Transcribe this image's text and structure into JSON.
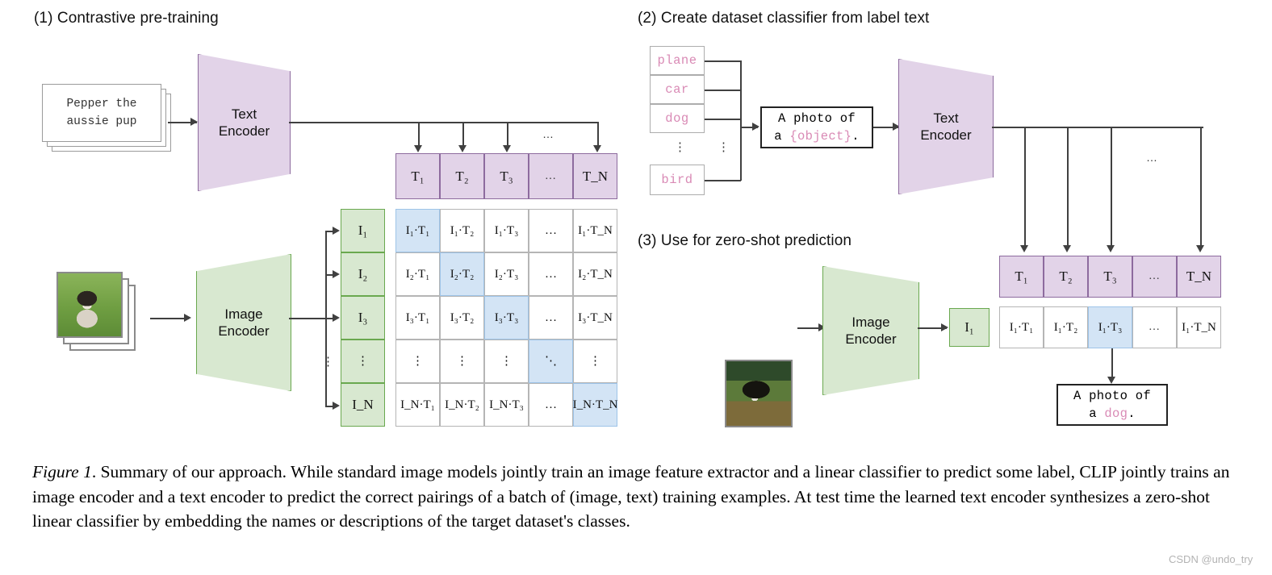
{
  "figure": {
    "watermark": "CSDN @undo_try",
    "caption_lead": "Figure 1",
    "caption_rest": ". Summary of our approach. While standard image models jointly train an image feature extractor and a linear classifier to predict some label, CLIP jointly trains an image encoder and a text encoder to predict the correct pairings of a batch of (image, text) training examples. At test time the learned text encoder synthesizes a zero-shot linear classifier by embedding the names or descriptions of the target dataset's classes."
  },
  "panel1": {
    "title": "(1) Contrastive pre-training",
    "text_sample_line1": "Pepper the",
    "text_sample_line2": "aussie pup",
    "text_encoder": {
      "line1": "Text",
      "line2": "Encoder"
    },
    "image_encoder": {
      "line1": "Image",
      "line2": "Encoder"
    },
    "text_vector": [
      "T₁",
      "T₂",
      "T₃",
      "…",
      "T_N"
    ],
    "image_vector": [
      "I₁",
      "I₂",
      "I₃",
      "⋮",
      "I_N"
    ],
    "matrix_rows": [
      [
        "I₁·T₁",
        "I₁·T₂",
        "I₁·T₃",
        "…",
        "I₁·T_N"
      ],
      [
        "I₂·T₁",
        "I₂·T₂",
        "I₂·T₃",
        "…",
        "I₂·T_N"
      ],
      [
        "I₃·T₁",
        "I₃·T₂",
        "I₃·T₃",
        "…",
        "I₃·T_N"
      ],
      [
        "⋮",
        "⋮",
        "⋮",
        "⋱",
        "⋮"
      ],
      [
        "I_N·T₁",
        "I_N·T₂",
        "I_N·T₃",
        "…",
        "I_N·T_N"
      ]
    ],
    "diagonal_highlight": [
      0,
      1,
      2,
      3,
      4
    ]
  },
  "panel2": {
    "title": "(2) Create dataset classifier from label text",
    "class_labels": [
      "plane",
      "car",
      "dog",
      "bird"
    ],
    "ellipsis": "⋮",
    "prompt_prefix": "A photo of",
    "prompt_article": "a ",
    "prompt_slot": "{object}",
    "prompt_suffix": ".",
    "text_encoder": {
      "line1": "Text",
      "line2": "Encoder"
    }
  },
  "panel3": {
    "title": "(3) Use for zero-shot prediction",
    "image_encoder": {
      "line1": "Image",
      "line2": "Encoder"
    },
    "image_feature": "I₁",
    "text_vector": [
      "T₁",
      "T₂",
      "T₃",
      "…",
      "T_N"
    ],
    "score_row": [
      "I₁·T₁",
      "I₁·T₂",
      "I₁·T₃",
      "…",
      "I₁·T_N"
    ],
    "predicted_index": 2,
    "result_prefix": "A photo of",
    "result_article": "a ",
    "result_class": "dog",
    "result_suffix": "."
  },
  "colors": {
    "text_encoder_fill": "#e2d3e8",
    "text_encoder_stroke": "#8d6b9e",
    "image_encoder_fill": "#d8e8d0",
    "image_encoder_stroke": "#6aa84f",
    "highlight_fill": "#d3e4f5",
    "highlight_stroke": "#9ec4e8",
    "class_label_text": "#d98ab5",
    "connector": "#404040"
  }
}
